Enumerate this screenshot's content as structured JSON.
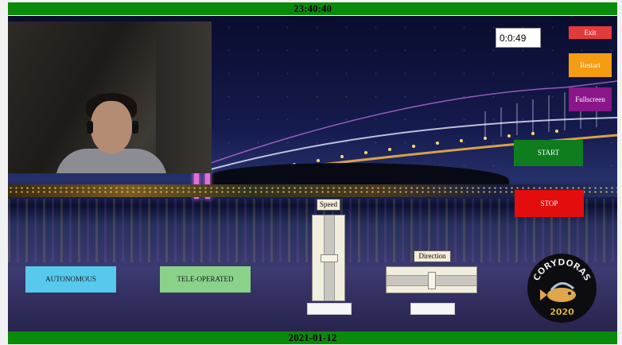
{
  "header": {
    "clock": "23:40:40"
  },
  "footer": {
    "date": "2021-01-12"
  },
  "timer": {
    "elapsed": "0:0:49"
  },
  "buttons": {
    "exit": "Exit",
    "restart": "Restart",
    "fullscreen": "Fullscreen",
    "start": "START",
    "stop": "STOP",
    "autonomous": "AUTONOMOUS",
    "teleoperated": "TELE-OPERATED"
  },
  "sliders": {
    "speed": {
      "label": "Speed",
      "value_fraction": 0.5
    },
    "direction": {
      "label": "Direction",
      "value_fraction": 0.5
    }
  },
  "logo": {
    "name": "CORYDORAS",
    "year": "2020"
  },
  "colors": {
    "bar": "#0a8a0a",
    "exit": "#e33b3b",
    "restart": "#f59c12",
    "fullscreen": "#8a168a",
    "start": "#0f7d1e",
    "stop": "#e30d0d",
    "autonomous": "#57c9ed",
    "teleoperated": "#8ad18a"
  }
}
